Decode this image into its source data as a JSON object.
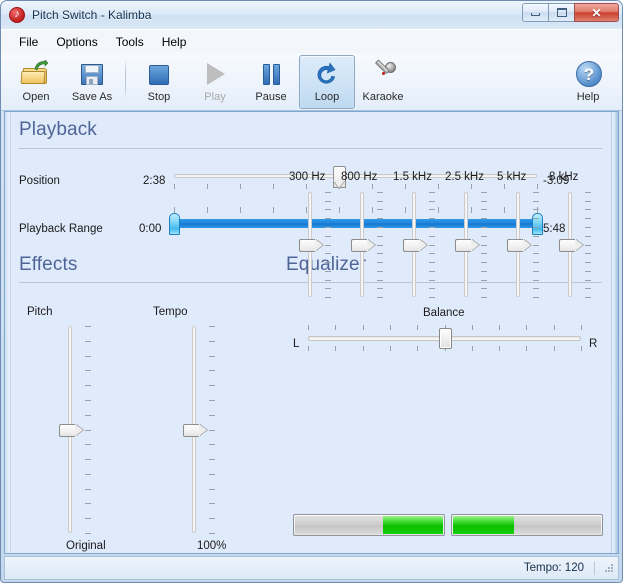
{
  "window": {
    "title": "Pitch Switch - Kalimba",
    "app_icon": "music-note-icon",
    "minimize": "–",
    "maximize": "□",
    "close": "✕"
  },
  "menubar": {
    "items": [
      {
        "label": "File"
      },
      {
        "label": "Options"
      },
      {
        "label": "Tools"
      },
      {
        "label": "Help"
      }
    ]
  },
  "toolbar": {
    "buttons": [
      {
        "label": "Open",
        "icon": "open-folder-icon",
        "state": "enabled"
      },
      {
        "label": "Save As",
        "icon": "floppy-disk-icon",
        "state": "enabled"
      },
      {
        "label": "Stop",
        "icon": "stop-square-icon",
        "state": "enabled"
      },
      {
        "label": "Play",
        "icon": "play-triangle-icon",
        "state": "disabled"
      },
      {
        "label": "Pause",
        "icon": "pause-bars-icon",
        "state": "enabled"
      },
      {
        "label": "Loop",
        "icon": "loop-arrow-icon",
        "state": "active"
      },
      {
        "label": "Karaoke",
        "icon": "microphone-icon",
        "state": "enabled"
      }
    ],
    "help": {
      "label": "Help",
      "icon": "question-mark-icon"
    }
  },
  "playback": {
    "heading": "Playback",
    "position": {
      "label": "Position",
      "elapsed": "2:38",
      "remaining": "-3:09",
      "thumb_percent": 45.5,
      "tick_count": 12
    },
    "range": {
      "label": "Playback Range",
      "start": "0:00",
      "end": "5:48",
      "start_percent": 0,
      "end_percent": 100,
      "tick_count": 12
    }
  },
  "effects": {
    "heading": "Effects",
    "sliders": [
      {
        "name": "Pitch",
        "value_label": "Original",
        "thumb_percent": 50,
        "tick_count": 15
      },
      {
        "name": "Tempo",
        "value_label": "100%",
        "thumb_percent": 50,
        "tick_count": 15
      }
    ]
  },
  "equalizer": {
    "heading": "Equalizer",
    "bands": [
      {
        "name": "300 Hz",
        "thumb_percent": 50,
        "tick_count": 13
      },
      {
        "name": "800 Hz",
        "thumb_percent": 50,
        "tick_count": 13
      },
      {
        "name": "1.5 kHz",
        "thumb_percent": 50,
        "tick_count": 13
      },
      {
        "name": "2.5 kHz",
        "thumb_percent": 50,
        "tick_count": 13
      },
      {
        "name": "5 kHz",
        "thumb_percent": 50,
        "tick_count": 13
      },
      {
        "name": "8 kHz",
        "thumb_percent": 50,
        "tick_count": 13
      }
    ],
    "balance": {
      "heading": "Balance",
      "left_label": "L",
      "right_label": "R",
      "thumb_percent": 50,
      "tick_count": 11
    },
    "meters": {
      "left_level_percent": 41,
      "right_level_percent": 41,
      "fill_color": "#0cc000"
    }
  },
  "statusbar": {
    "text": "Tempo: 120"
  },
  "colors": {
    "section_heading": "#4f6597",
    "panel_background": "#dfeafb",
    "range_bar": "#1f86dc",
    "meter_green": "#0cc000"
  }
}
